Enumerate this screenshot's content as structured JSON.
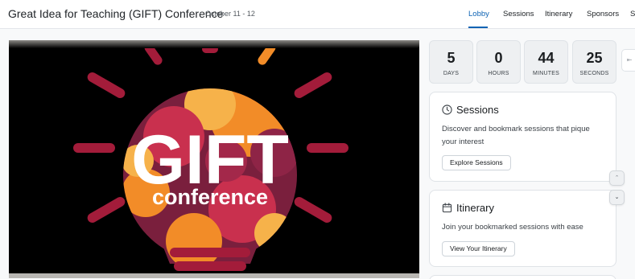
{
  "header": {
    "title": "Great Idea for Teaching (GIFT) Conference",
    "separator": "·",
    "date": "October 11 - 12"
  },
  "nav": {
    "items": [
      {
        "label": "Lobby",
        "active": true
      },
      {
        "label": "Sessions",
        "active": false
      },
      {
        "label": "Itinerary",
        "active": false
      },
      {
        "label": "Sponsors",
        "active": false
      },
      {
        "label": "S",
        "active": false
      }
    ]
  },
  "hero": {
    "logo_word": "GIFT",
    "logo_sub": "conference",
    "colors": {
      "dark": "#7a1f3d",
      "orange": "#f28c28",
      "light": "#f6b24a",
      "rays": "#a31c3a",
      "background": "#000000"
    }
  },
  "countdown": [
    {
      "value": "5",
      "unit": "DAYS"
    },
    {
      "value": "0",
      "unit": "HOURS"
    },
    {
      "value": "44",
      "unit": "MINUTES"
    },
    {
      "value": "25",
      "unit": "SECONDS"
    }
  ],
  "side_toggle_icon": "collapse-arrow-icon",
  "cards": {
    "sessions": {
      "icon": "clock-icon",
      "title": "Sessions",
      "description": "Discover and bookmark sessions that pique your interest",
      "button": "Explore Sessions"
    },
    "itinerary": {
      "icon": "calendar-icon",
      "title": "Itinerary",
      "description": "Join your bookmarked sessions with ease",
      "button": "View Your Itinerary"
    }
  },
  "scroll_icons": {
    "up": "chevron-up-icon",
    "down": "chevron-down-icon"
  },
  "accent_color": "#0d63b4"
}
